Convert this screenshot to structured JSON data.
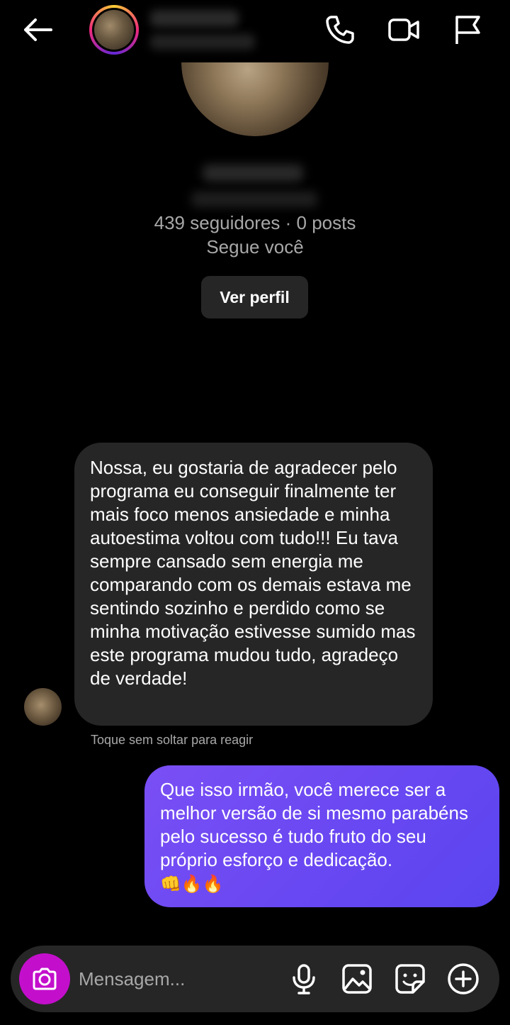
{
  "header": {
    "back_icon": "arrow-left-icon",
    "phone_icon": "phone-icon",
    "video_icon": "video-camera-icon",
    "flag_icon": "flag-icon"
  },
  "profile": {
    "stats": "439 seguidores · 0 posts",
    "follows_you": "Segue você",
    "view_profile_label": "Ver perfil"
  },
  "messages": {
    "received": "Nossa, eu gostaria de agradecer pelo programa eu conseguir finalmente ter mais foco menos ansiedade e minha autoestima voltou com tudo!!! Eu tava sempre cansado sem energia me comparando com os demais estava me sentindo sozinho e perdido como se minha motivação estivesse sumido mas este programa mudou tudo, agradeço de verdade!",
    "received_hint": "Toque sem soltar para reagir",
    "sent": "Que isso irmão, você merece ser a melhor versão de si mesmo parabéns pelo sucesso é tudo fruto do seu próprio esforço e dedicação.",
    "sent_emoji": "👊🔥🔥"
  },
  "composer": {
    "placeholder": "Mensagem...",
    "camera_color": "#c30fcc",
    "icons": [
      "camera-icon",
      "microphone-icon",
      "gallery-icon",
      "sticker-icon",
      "plus-circle-icon"
    ]
  },
  "colors": {
    "background": "#000000",
    "received_bubble": "#262626",
    "sent_bubble": "#6a48f2"
  }
}
